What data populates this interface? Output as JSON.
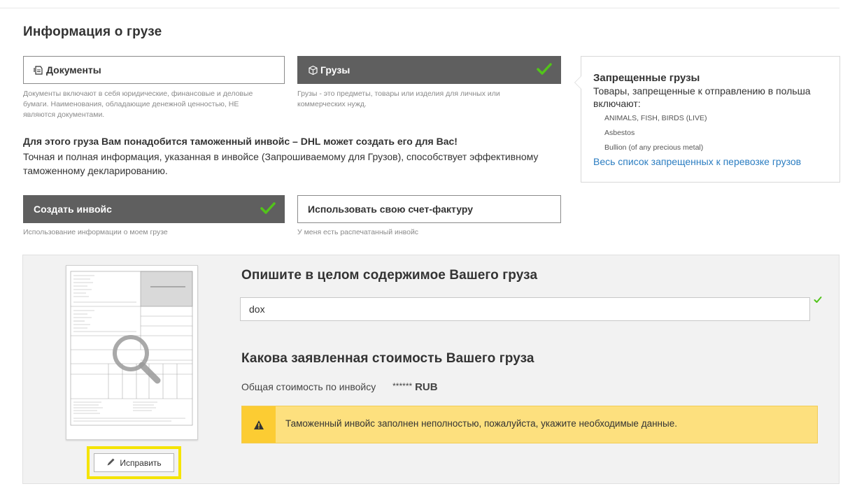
{
  "section": {
    "title": "Информация о грузе"
  },
  "shipment_types": [
    {
      "label": "Документы",
      "icon": "documents-icon",
      "selected": false,
      "description": "Документы включают в себя юридические, финансовые и деловые бумаги. Наименования, обладающие денежной ценностью, НЕ являются документами."
    },
    {
      "label": "Грузы",
      "icon": "package-icon",
      "selected": true,
      "description": "Грузы - это предметы, товары или изделия для личных или коммерческих нужд."
    }
  ],
  "prohibited": {
    "title": "Запрещенные грузы",
    "intro": "Товары, запрещенные к отправлению в польша включают:",
    "items": [
      "ANIMALS, FISH, BIRDS (LIVE)",
      "Asbestos",
      "Bullion (of any precious metal)"
    ],
    "link": "Весь список запрещенных к перевозке грузов"
  },
  "invoice_notice": {
    "headline": "Для этого груза Вам понадобится таможенный инвойс – DHL может создать его для Вас!",
    "text": "Точная и полная информация, указанная в инвойсе (Запрошиваемому для Грузов), способствует эффективному таможенному декларированию."
  },
  "invoice_options": [
    {
      "label": "Создать инвойс",
      "selected": true,
      "description": "Использование информации о моем грузе"
    },
    {
      "label": "Использовать свою счет-фактуру",
      "selected": false,
      "description": "У меня есть распечатанный инвойс"
    }
  ],
  "invoice_preview": {
    "edit_label": "Исправить"
  },
  "contents": {
    "heading": "Опишите в целом содержимое Вашего груза",
    "value": "dox"
  },
  "value": {
    "heading": "Какова заявленная стоимость Вашего груза",
    "total_label": "Общая стоимость по инвойсу",
    "total_masked": "******",
    "currency": "RUB"
  },
  "warning": {
    "text": "Таможенный инвойс заполнен неполностью, пожалуйста, укажите необходимые данные."
  },
  "colors": {
    "accent_green": "#52c41a",
    "selected_tile": "#5f5f5f",
    "link": "#2b7dc1",
    "warning_bg": "#fde07e",
    "highlight": "#f5e400"
  }
}
